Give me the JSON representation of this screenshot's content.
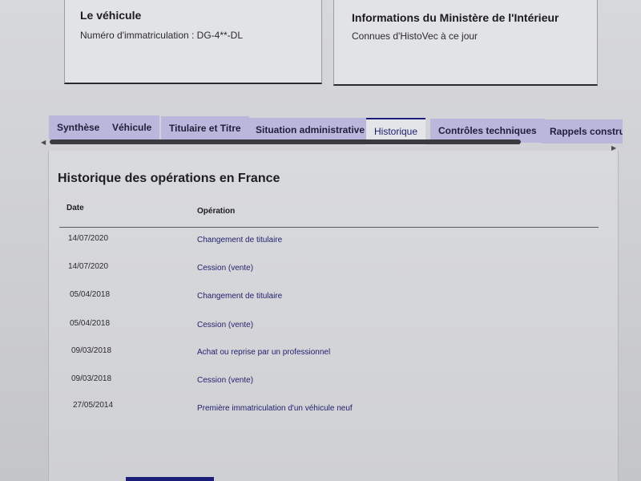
{
  "cards": {
    "vehicle": {
      "title": "Le véhicule",
      "text": "Numéro d'immatriculation : DG-4**-DL"
    },
    "ministry": {
      "title": "Informations du Ministère de l'Intérieur",
      "text": "Connues d'HistoVec à ce jour"
    }
  },
  "tabs": [
    {
      "label": "Synthèse"
    },
    {
      "label": "Véhicule"
    },
    {
      "label": "Titulaire et Titre"
    },
    {
      "label": "Situation administrative"
    },
    {
      "label": "Historique"
    },
    {
      "label": "Contrôles techniques"
    },
    {
      "label": "Rappels constructeur"
    }
  ],
  "active_tab": "Historique",
  "history": {
    "title": "Historique des opérations en France",
    "columns": {
      "date": "Date",
      "operation": "Opération"
    },
    "rows": [
      {
        "date": "14/07/2020",
        "operation": "Changement de titulaire"
      },
      {
        "date": "14/07/2020",
        "operation": "Cession (vente)"
      },
      {
        "date": "05/04/2018",
        "operation": "Changement de titulaire"
      },
      {
        "date": "05/04/2018",
        "operation": "Cession (vente)"
      },
      {
        "date": "09/03/2018",
        "operation": "Achat ou reprise par un professionnel"
      },
      {
        "date": "09/03/2018",
        "operation": "Cession (vente)"
      },
      {
        "date": "27/05/2014",
        "operation": "Première immatriculation d'un véhicule neuf"
      }
    ]
  },
  "colors": {
    "accent": "#1d1d7a",
    "tab_inactive": "#b9b7dc",
    "link": "#22226e"
  }
}
